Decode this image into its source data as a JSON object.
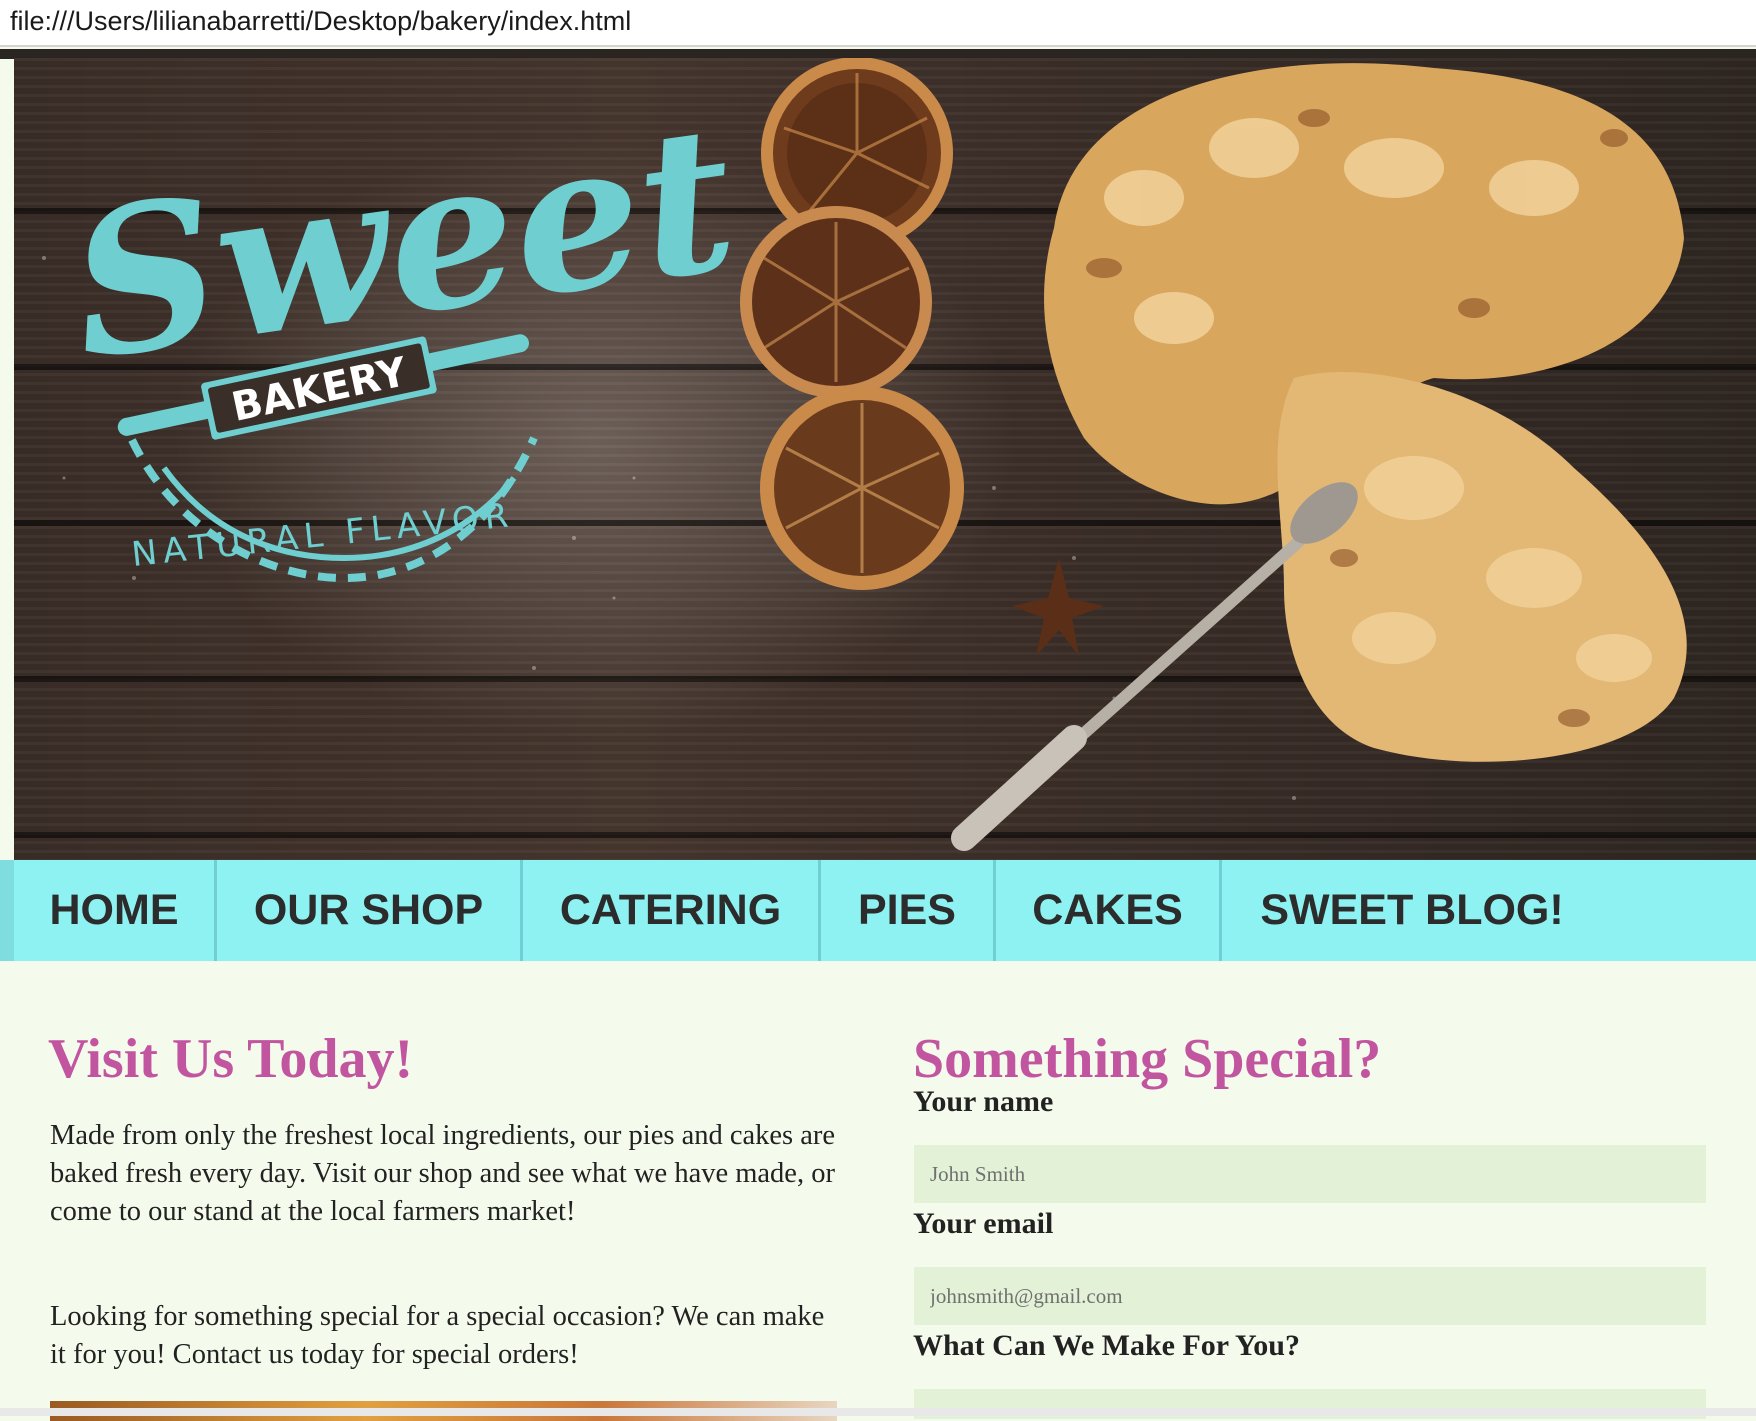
{
  "browser": {
    "url": "file:///Users/lilianabarretti/Desktop/bakery/index.html"
  },
  "hero": {
    "logo_word": "Sweet",
    "logo_banner": "BAKERY",
    "logo_tagline": "NATURAL FLAVOR",
    "colors": {
      "logo": "#6fcfd0",
      "wood": "#3b2e28"
    }
  },
  "nav": {
    "items": [
      {
        "label": "HOME"
      },
      {
        "label": "OUR SHOP"
      },
      {
        "label": "CATERING"
      },
      {
        "label": "PIES"
      },
      {
        "label": "CAKES"
      },
      {
        "label": "SWEET BLOG!"
      }
    ],
    "colors": {
      "background": "#8df2f1",
      "text": "#2c2c2c"
    }
  },
  "visit": {
    "heading": "Visit Us Today!",
    "paragraph1": "Made from only the freshest local ingredients, our pies and cakes are baked fresh every day. Visit our shop and see what we have made, or come to our stand at the local farmers market!",
    "paragraph2": "Looking for something special for a special occasion? We can make it for you! Contact us today for special orders!"
  },
  "special": {
    "heading": "Something Special?",
    "name_label": "Your name",
    "name_placeholder": "John Smith",
    "email_label": "Your email",
    "email_placeholder": "johnsmith@gmail.com",
    "request_label": "What Can We Make For You?"
  },
  "colors": {
    "heading": "#c2559f",
    "page_bg": "#f5fbec",
    "input_bg": "#e3f2d6"
  }
}
